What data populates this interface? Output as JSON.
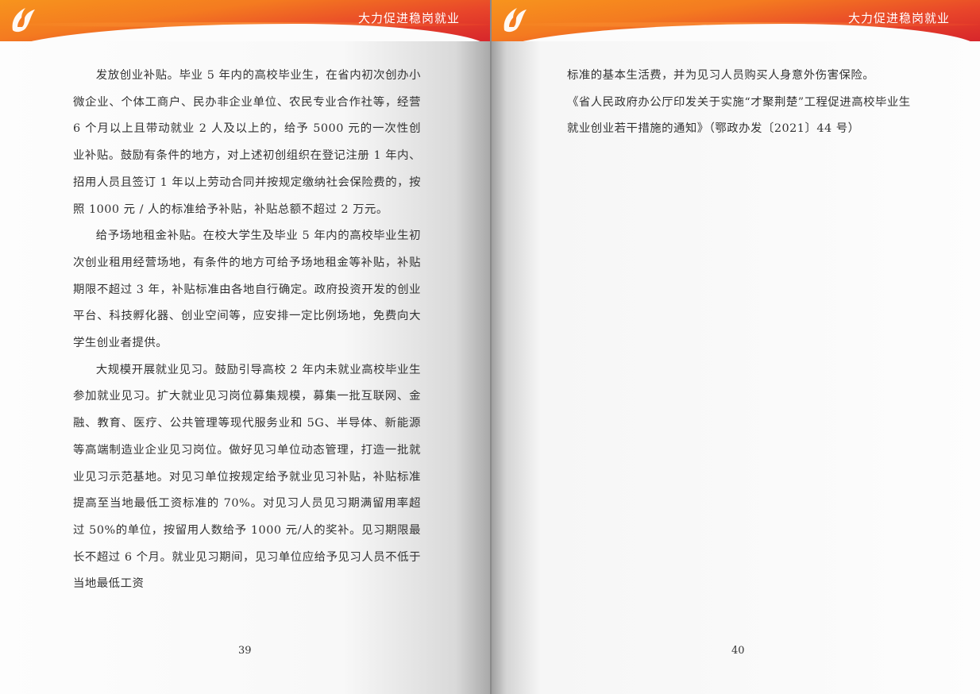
{
  "header": {
    "title": "大力促进稳岗就业"
  },
  "left_page": {
    "paragraphs": [
      "发放创业补贴。毕业 5 年内的高校毕业生，在省内初次创办小微企业、个体工商户、民办非企业单位、农民专业合作社等，经营 6 个月以上且带动就业 2 人及以上的，给予 5000 元的一次性创业补贴。鼓励有条件的地方，对上述初创组织在登记注册 1 年内、招用人员且签订 1 年以上劳动合同并按规定缴纳社会保险费的，按照 1000 元 / 人的标准给予补贴，补贴总额不超过 2 万元。",
      "给予场地租金补贴。在校大学生及毕业 5 年内的高校毕业生初次创业租用经营场地，有条件的地方可给予场地租金等补贴，补贴期限不超过 3 年，补贴标准由各地自行确定。政府投资开发的创业平台、科技孵化器、创业空间等，应安排一定比例场地，免费向大学生创业者提供。",
      "大规模开展就业见习。鼓励引导高校 2 年内未就业高校毕业生参加就业见习。扩大就业见习岗位募集规模，募集一批互联网、金融、教育、医疗、公共管理等现代服务业和 5G、半导体、新能源等高端制造业企业见习岗位。做好见习单位动态管理，打造一批就业见习示范基地。对见习单位按规定给予就业见习补贴，补贴标准提高至当地最低工资标准的 70%。对见习人员见习期满留用率超过 50%的单位，按留用人数给予 1000 元/人的奖补。见习期限最长不超过 6 个月。就业见习期间，见习单位应给予见习人员不低于当地最低工资"
    ],
    "page_number": "39"
  },
  "right_page": {
    "paragraphs": [
      "标准的基本生活费，并为见习人员购买人身意外伤害保险。",
      "《省人民政府办公厅印发关于实施“才聚荆楚”工程促进高校毕业生就业创业若干措施的通知》（鄂政办发〔2021〕44 号）"
    ],
    "page_number": "40"
  },
  "colors": {
    "header_orange": "#f47b20",
    "header_red": "#d7262b",
    "text": "#333333"
  }
}
